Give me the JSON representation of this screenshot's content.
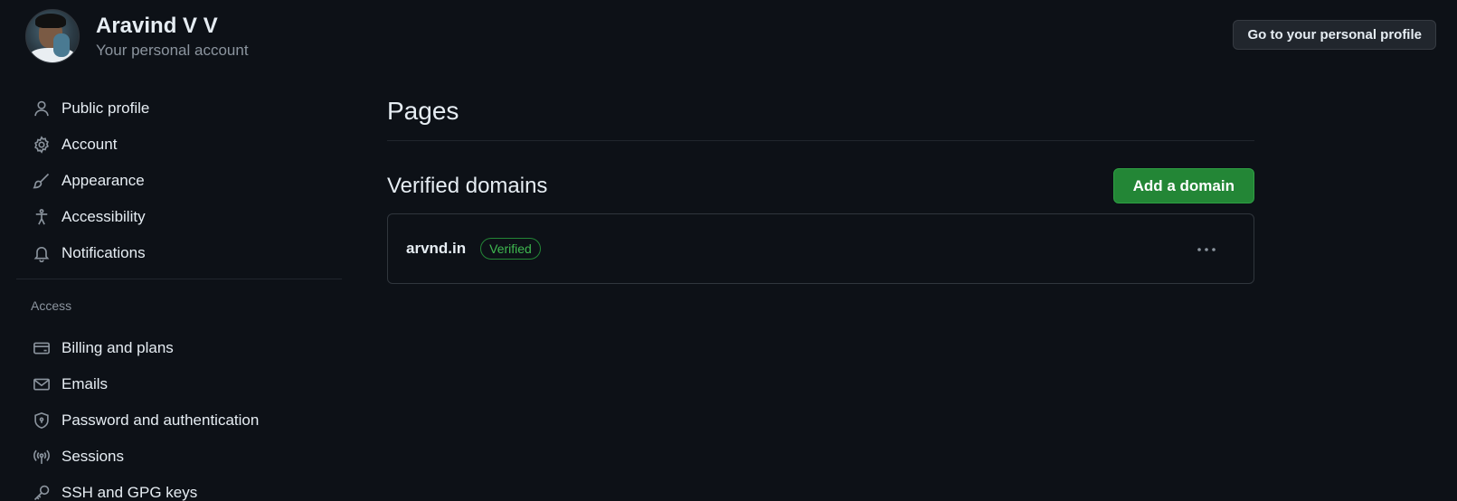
{
  "header": {
    "name": "Aravind V V",
    "subtitle": "Your personal account",
    "profile_button": "Go to your personal profile"
  },
  "sidebar": {
    "items": [
      {
        "label": "Public profile",
        "icon": "person-icon"
      },
      {
        "label": "Account",
        "icon": "gear-icon"
      },
      {
        "label": "Appearance",
        "icon": "paintbrush-icon"
      },
      {
        "label": "Accessibility",
        "icon": "accessibility-icon"
      },
      {
        "label": "Notifications",
        "icon": "bell-icon"
      }
    ],
    "access_label": "Access",
    "access_items": [
      {
        "label": "Billing and plans",
        "icon": "credit-card-icon"
      },
      {
        "label": "Emails",
        "icon": "mail-icon"
      },
      {
        "label": "Password and authentication",
        "icon": "shield-lock-icon"
      },
      {
        "label": "Sessions",
        "icon": "broadcast-icon"
      },
      {
        "label": "SSH and GPG keys",
        "icon": "key-icon"
      }
    ]
  },
  "main": {
    "title": "Pages",
    "verified_domains_title": "Verified domains",
    "add_button": "Add a domain",
    "domains": [
      {
        "name": "arvnd.in",
        "status": "Verified"
      }
    ]
  },
  "colors": {
    "background": "#0d1117",
    "accent_green": "#238636",
    "verified_green": "#3fb950",
    "muted_text": "#8b949e"
  }
}
